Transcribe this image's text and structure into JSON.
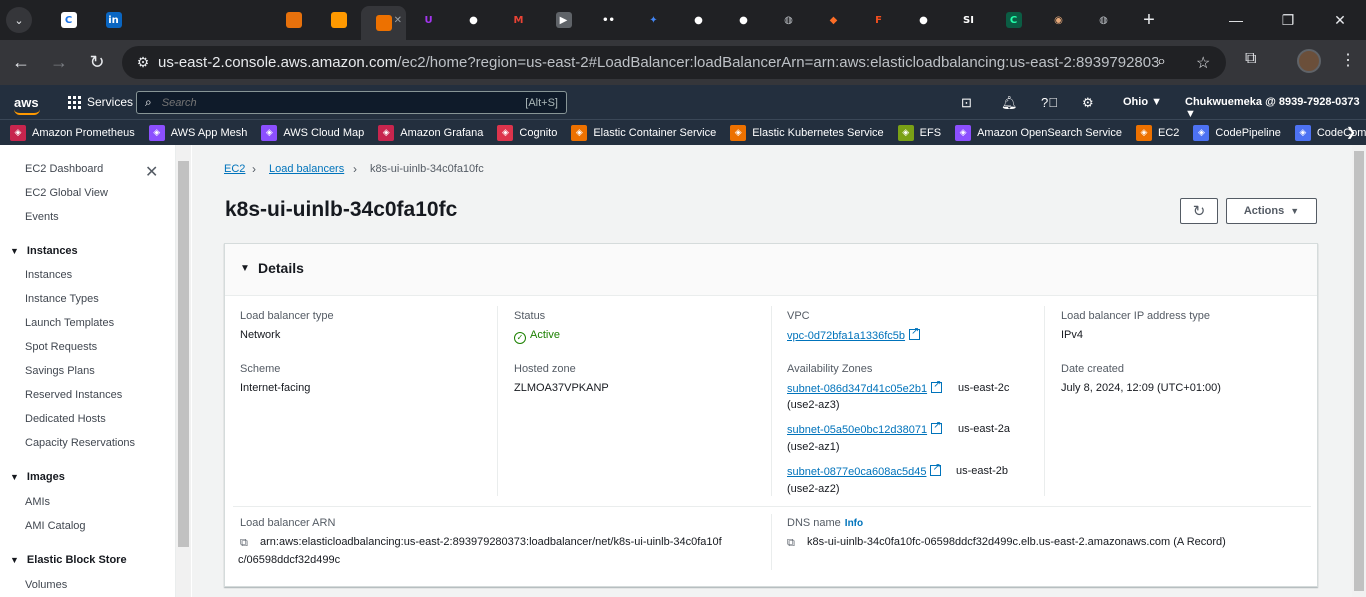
{
  "browser": {
    "tabs": [
      {
        "icon": "chrome-icon",
        "label": "C",
        "color": "#1a73e8",
        "bg": "#fff"
      },
      {
        "icon": "linkedin-icon",
        "label": "in",
        "color": "#fff",
        "bg": "#0a66c2"
      },
      {
        "icon": "google-cloud-icon",
        "label": "",
        "color": "#fbbc04",
        "bg": "transparent"
      },
      {
        "icon": "google-cloud-icon",
        "label": "",
        "color": "#4285f4",
        "bg": "transparent"
      },
      {
        "icon": "google-cloud-icon",
        "label": "",
        "color": "#ea4335",
        "bg": "transparent"
      },
      {
        "icon": "aws-service-icon",
        "label": "",
        "color": "#fff",
        "bg": "#e7710c"
      },
      {
        "icon": "aws-service-icon",
        "label": "",
        "color": "#fff",
        "bg": "#ff9900"
      },
      {
        "icon": "aws-ec2-icon",
        "label": "",
        "color": "#fff",
        "bg": "#ed7100",
        "active": true
      },
      {
        "icon": "udemy-icon",
        "label": "U",
        "color": "#a435f0",
        "bg": "transparent"
      },
      {
        "icon": "github-icon",
        "label": "●",
        "color": "#fff",
        "bg": "transparent"
      },
      {
        "icon": "gmail-icon",
        "label": "M",
        "color": "#ea4335",
        "bg": "transparent"
      },
      {
        "icon": "youtube-icon",
        "label": "▶",
        "color": "#fff",
        "bg": "#5f6368"
      },
      {
        "icon": "bot-icon",
        "label": "••",
        "color": "#fff",
        "bg": "transparent"
      },
      {
        "icon": "gemini-icon",
        "label": "✦",
        "color": "#4285f4",
        "bg": "transparent"
      },
      {
        "icon": "github-icon",
        "label": "●",
        "color": "#fff",
        "bg": "transparent"
      },
      {
        "icon": "github-icon",
        "label": "●",
        "color": "#fff",
        "bg": "transparent"
      },
      {
        "icon": "globe-icon",
        "label": "◍",
        "color": "#bdc1c6",
        "bg": "transparent"
      },
      {
        "icon": "gitlab-icon",
        "label": "◆",
        "color": "#fc6d26",
        "bg": "transparent"
      },
      {
        "icon": "figma-icon",
        "label": "F",
        "color": "#f24e1e",
        "bg": "transparent"
      },
      {
        "icon": "github-icon",
        "label": "●",
        "color": "#fff",
        "bg": "transparent"
      },
      {
        "icon": "stack-icon",
        "label": "SI",
        "color": "#fff",
        "bg": "transparent"
      },
      {
        "icon": "coursera-icon",
        "label": "C",
        "color": "#2fa",
        "bg": "#0b5d44"
      },
      {
        "icon": "avatar-icon",
        "label": "◉",
        "color": "#e8aa7a",
        "bg": "transparent"
      },
      {
        "icon": "globe-icon",
        "label": "◍",
        "color": "#bdc1c6",
        "bg": "transparent"
      }
    ],
    "url_host": "us-east-2.console.aws.amazon.com",
    "url_rest": "/ec2/home?region=us-east-2#LoadBalancer:loadBalancerArn=arn:aws:elasticloadbalancing:us-east-2:893979280373:loadbala..."
  },
  "awsnav": {
    "services_label": "Services",
    "search_placeholder": "Search",
    "search_shortcut": "[Alt+S]",
    "region": "Ohio ▼",
    "account": "Chukwuemeka @ 8939-7928-0373 ▼"
  },
  "favorites": [
    {
      "label": "Amazon Prometheus",
      "color": "#c7254e"
    },
    {
      "label": "AWS App Mesh",
      "color": "#8c4fff"
    },
    {
      "label": "AWS Cloud Map",
      "color": "#8c4fff"
    },
    {
      "label": "Amazon Grafana",
      "color": "#c7254e"
    },
    {
      "label": "Cognito",
      "color": "#dd344c"
    },
    {
      "label": "Elastic Container Service",
      "color": "#ed7100"
    },
    {
      "label": "Elastic Kubernetes Service",
      "color": "#ed7100"
    },
    {
      "label": "EFS",
      "color": "#7aa116"
    },
    {
      "label": "Amazon OpenSearch Service",
      "color": "#8c4fff"
    },
    {
      "label": "EC2",
      "color": "#ed7100"
    },
    {
      "label": "CodePipeline",
      "color": "#4d72f3"
    },
    {
      "label": "CodeCommit",
      "color": "#4d72f3"
    },
    {
      "label": "Code",
      "color": "#4d72f3"
    }
  ],
  "sidebar": {
    "top": [
      "EC2 Dashboard",
      "EC2 Global View",
      "Events"
    ],
    "instances_section": "Instances",
    "instances_items": [
      "Instances",
      "Instance Types",
      "Launch Templates",
      "Spot Requests",
      "Savings Plans",
      "Reserved Instances",
      "Dedicated Hosts",
      "Capacity Reservations"
    ],
    "images_section": "Images",
    "images_items": [
      "AMIs",
      "AMI Catalog"
    ],
    "ebs_section": "Elastic Block Store",
    "ebs_items": [
      "Volumes"
    ]
  },
  "breadcrumb": {
    "root": "EC2",
    "parent": "Load balancers",
    "current": "k8s-ui-uinlb-34c0fa10fc"
  },
  "page": {
    "title": "k8s-ui-uinlb-34c0fa10fc",
    "actions_label": "Actions"
  },
  "details": {
    "header": "Details",
    "lb_type_label": "Load balancer type",
    "lb_type": "Network",
    "status_label": "Status",
    "status": "Active",
    "vpc_label": "VPC",
    "vpc": "vpc-0d72bfa1a1336fc5b",
    "ip_type_label": "Load balancer IP address type",
    "ip_type": "IPv4",
    "scheme_label": "Scheme",
    "scheme": "Internet-facing",
    "hosted_zone_label": "Hosted zone",
    "hosted_zone": "ZLMOA37VPKANP",
    "az_label": "Availability Zones",
    "azs": [
      {
        "subnet": "subnet-086d347d41c05e2b1",
        "zone": "us-east-2c",
        "az": "(use2-az3)"
      },
      {
        "subnet": "subnet-05a50e0bc12d38071",
        "zone": "us-east-2a",
        "az": "(use2-az1)"
      },
      {
        "subnet": "subnet-0877e0ca608ac5d45",
        "zone": "us-east-2b",
        "az": "(use2-az2)"
      }
    ],
    "date_label": "Date created",
    "date": "July 8, 2024, 12:09 (UTC+01:00)",
    "arn_label": "Load balancer ARN",
    "arn_line1": "arn:aws:elasticloadbalancing:us-east-2:893979280373:loadbalancer/net/k8s-ui-uinlb-34c0fa10f",
    "arn_line2": "c/06598ddcf32d499c",
    "dns_label": "DNS name",
    "dns_info": "Info",
    "dns": "k8s-ui-uinlb-34c0fa10fc-06598ddcf32d499c.elb.us-east-2.amazonaws.com (A Record)"
  }
}
